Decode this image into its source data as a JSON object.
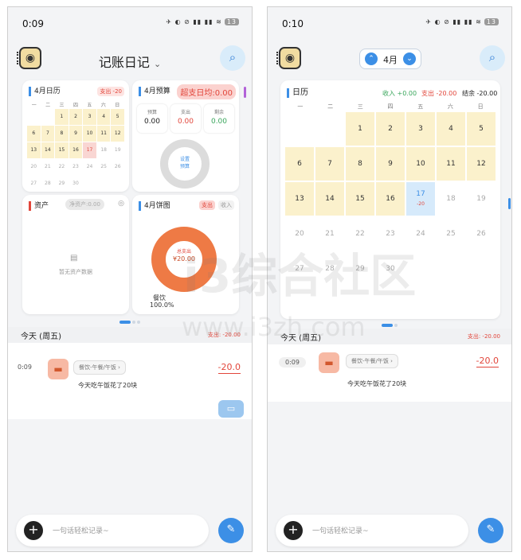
{
  "status": {
    "time_left": "0:09",
    "time_right": "0:10",
    "icons": "✈ ◐ ⊘ ▮▮ ▮▮ ≋",
    "battery": "13"
  },
  "left": {
    "app_title": "记账日记",
    "cards": {
      "calendar": {
        "title": "4月日历",
        "expense_tag": "支出 -20",
        "weekdays": [
          "一",
          "二",
          "三",
          "四",
          "五",
          "六",
          "日"
        ],
        "days": [
          {
            "d": "",
            "s": "blank"
          },
          {
            "d": "",
            "s": "blank"
          },
          {
            "d": "1",
            "s": "hi"
          },
          {
            "d": "2",
            "s": "hi"
          },
          {
            "d": "3",
            "s": "hi"
          },
          {
            "d": "4",
            "s": "hi"
          },
          {
            "d": "5",
            "s": "hi"
          },
          {
            "d": "6",
            "s": "hi"
          },
          {
            "d": "7",
            "s": "hi"
          },
          {
            "d": "8",
            "s": "hi"
          },
          {
            "d": "9",
            "s": "hi"
          },
          {
            "d": "10",
            "s": "hi"
          },
          {
            "d": "11",
            "s": "hi"
          },
          {
            "d": "12",
            "s": "hi"
          },
          {
            "d": "13",
            "s": "hi"
          },
          {
            "d": "14",
            "s": "hi"
          },
          {
            "d": "15",
            "s": "hi"
          },
          {
            "d": "16",
            "s": "hi"
          },
          {
            "d": "17",
            "s": "today"
          },
          {
            "d": "18",
            "s": "dim"
          },
          {
            "d": "19",
            "s": "dim"
          },
          {
            "d": "20",
            "s": "dim"
          },
          {
            "d": "21",
            "s": "dim"
          },
          {
            "d": "22",
            "s": "dim"
          },
          {
            "d": "23",
            "s": "dim"
          },
          {
            "d": "24",
            "s": "dim"
          },
          {
            "d": "25",
            "s": "dim"
          },
          {
            "d": "26",
            "s": "dim"
          },
          {
            "d": "27",
            "s": "dim"
          },
          {
            "d": "28",
            "s": "dim"
          },
          {
            "d": "29",
            "s": "dim"
          },
          {
            "d": "30",
            "s": "dim"
          }
        ]
      },
      "budget": {
        "title": "4月预算",
        "overspend_tag": "超支日均:0.00",
        "stats": [
          {
            "label": "预算",
            "value": "0.00",
            "color": "#222222"
          },
          {
            "label": "支出",
            "value": "0.00",
            "color": "#e2463b"
          },
          {
            "label": "剩余",
            "value": "0.00",
            "color": "#3aa65c"
          }
        ],
        "set_budget": "设置\n预算"
      },
      "assets": {
        "title": "资产",
        "total_tag": "净资产:0.00",
        "empty_text": "暂无资产数据"
      },
      "pie": {
        "title": "4月饼图",
        "tab_expense": "支出",
        "tab_income": "收入",
        "center_label": "总支出",
        "center_value": "¥20.00",
        "category": "餐饮",
        "percent": "100.0%"
      }
    },
    "day": {
      "label": "今天 (周五)",
      "total": "支出: -20.00"
    },
    "record": {
      "time": "0:09",
      "category": "餐饮-午餐/午饭",
      "amount": "-20.0",
      "note": "今天吃午饭花了20块"
    },
    "input_placeholder": "一句话轻松记录~"
  },
  "right": {
    "month_label": "4月",
    "calendar": {
      "title": "日历",
      "income": "收入 +0.00",
      "expense": "支出 -20.00",
      "balance": "结余 -20.00",
      "weekdays": [
        "一",
        "二",
        "三",
        "四",
        "五",
        "六",
        "日"
      ],
      "days": [
        {
          "d": "",
          "s": "blank"
        },
        {
          "d": "",
          "s": "blank"
        },
        {
          "d": "1",
          "s": "hi"
        },
        {
          "d": "2",
          "s": "hi"
        },
        {
          "d": "3",
          "s": "hi"
        },
        {
          "d": "4",
          "s": "hi"
        },
        {
          "d": "5",
          "s": "hi"
        },
        {
          "d": "6",
          "s": "hi"
        },
        {
          "d": "7",
          "s": "hi"
        },
        {
          "d": "8",
          "s": "hi"
        },
        {
          "d": "9",
          "s": "hi"
        },
        {
          "d": "10",
          "s": "hi"
        },
        {
          "d": "11",
          "s": "hi"
        },
        {
          "d": "12",
          "s": "hi"
        },
        {
          "d": "13",
          "s": "hi"
        },
        {
          "d": "14",
          "s": "hi"
        },
        {
          "d": "15",
          "s": "hi"
        },
        {
          "d": "16",
          "s": "hi"
        },
        {
          "d": "17",
          "s": "selected",
          "sub": "-20"
        },
        {
          "d": "18",
          "s": "dim"
        },
        {
          "d": "19",
          "s": "dim"
        },
        {
          "d": "20",
          "s": "dim"
        },
        {
          "d": "21",
          "s": "dim"
        },
        {
          "d": "22",
          "s": "dim"
        },
        {
          "d": "23",
          "s": "dim"
        },
        {
          "d": "24",
          "s": "dim"
        },
        {
          "d": "25",
          "s": "dim"
        },
        {
          "d": "26",
          "s": "dim"
        },
        {
          "d": "27",
          "s": "dim"
        },
        {
          "d": "28",
          "s": "dim"
        },
        {
          "d": "29",
          "s": "dim"
        },
        {
          "d": "30",
          "s": "dim"
        }
      ]
    },
    "day": {
      "label": "今天 (周五)",
      "total": "支出: -20.00"
    },
    "record": {
      "time": "0:09",
      "category": "餐饮-午餐/午饭",
      "amount": "-20.0",
      "note": "今天吃午饭花了20块"
    },
    "input_placeholder": "一句话轻松记录~"
  },
  "watermark": {
    "text": "i3综合社区",
    "url": "www.i3zh.com"
  },
  "colors": {
    "accent": "#3c8fe6",
    "expense": "#e2463b",
    "income": "#3aa65c",
    "highlight": "#fbf1cc",
    "pie": "#ee7a45"
  },
  "icons": {
    "notebook": "notebook-icon",
    "search": "search-icon",
    "burger": "food-icon",
    "chat": "chat-icon",
    "plus": "plus-icon",
    "edit": "edit-icon"
  }
}
